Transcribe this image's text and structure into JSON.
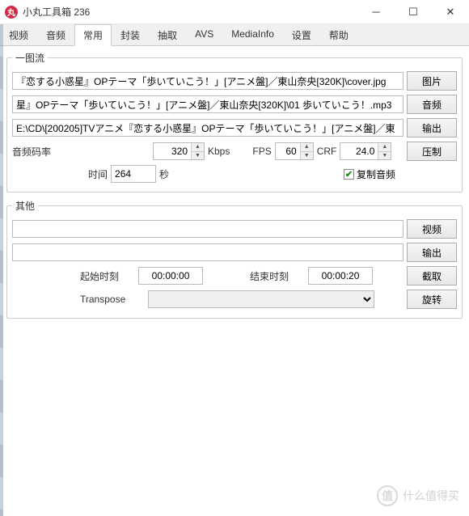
{
  "window": {
    "title": "小丸工具箱 236",
    "icon_char": "丸"
  },
  "tabs": {
    "items": [
      "视频",
      "音频",
      "常用",
      "封装",
      "抽取",
      "AVS",
      "MediaInfo",
      "设置",
      "帮助"
    ],
    "active_index": 2
  },
  "section1": {
    "legend": "一图流",
    "image_path": "﻿﻿『恋する小惑星』OPテーマ「歩いていこう！」[アニメ盤]／東山奈央[320K]\\cover.jpg",
    "audio_path": "星』OPテーマ「歩いていこう！」[アニメ盤]／東山奈央[320K]\\01 歩いていこう！.mp3",
    "output_path": "E:\\CD\\[200205]TVアニメ『恋する小惑星』OPテーマ「歩いていこう！」[アニメ盤]／東",
    "btn_image": "图片",
    "btn_audio": "音频",
    "btn_output": "输出",
    "btn_compress": "压制",
    "label_bitrate": "音频码率",
    "bitrate": "320",
    "bitrate_unit": "Kbps",
    "label_fps": "FPS",
    "fps": "60",
    "label_crf": "CRF",
    "crf": "24.0",
    "label_time": "时间",
    "time": "264",
    "time_unit": "秒",
    "copy_audio_label": "复制音频",
    "copy_audio_checked": true
  },
  "section2": {
    "legend": "其他",
    "video_path": "",
    "output_path": "",
    "btn_video": "视频",
    "btn_output": "输出",
    "btn_cut": "截取",
    "btn_rotate": "旋转",
    "label_start": "起始时刻",
    "start_time": "00:00:00",
    "label_end": "结束时刻",
    "end_time": "00:00:20",
    "label_transpose": "Transpose",
    "transpose_selected": ""
  },
  "watermark": {
    "icon": "值",
    "text": "什么值得买"
  }
}
